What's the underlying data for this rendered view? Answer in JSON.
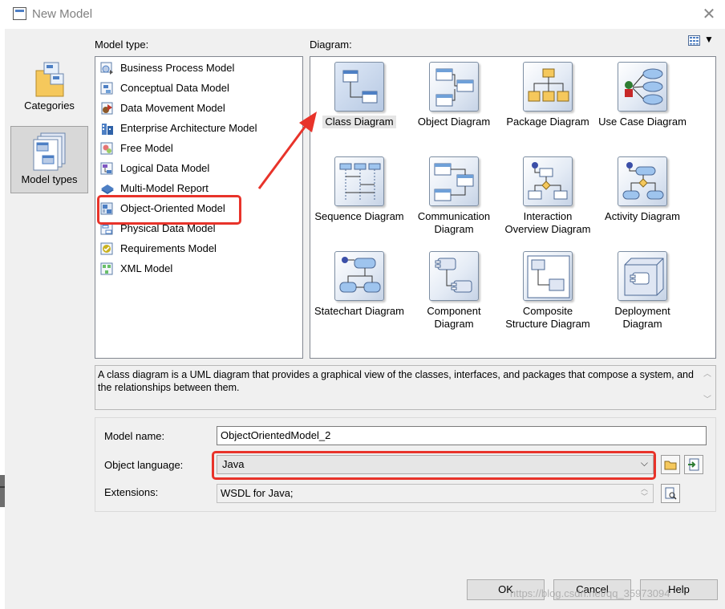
{
  "window": {
    "title": "New Model",
    "close_glyph": "✕"
  },
  "categories": [
    {
      "label": "Categories",
      "icon": "folder-icon"
    },
    {
      "label": "Model types",
      "icon": "model-types-icon"
    }
  ],
  "model_type_label": "Model type:",
  "diagram_label": "Diagram:",
  "model_types": [
    {
      "label": "Business Process Model",
      "icon": "business-process-icon"
    },
    {
      "label": "Conceptual Data Model",
      "icon": "conceptual-data-icon"
    },
    {
      "label": "Data Movement Model",
      "icon": "data-movement-icon"
    },
    {
      "label": "Enterprise Architecture Model",
      "icon": "enterprise-architecture-icon"
    },
    {
      "label": "Free Model",
      "icon": "free-model-icon"
    },
    {
      "label": "Logical Data Model",
      "icon": "logical-data-icon"
    },
    {
      "label": "Multi-Model Report",
      "icon": "report-icon"
    },
    {
      "label": "Object-Oriented Model",
      "icon": "object-oriented-icon"
    },
    {
      "label": "Physical Data Model",
      "icon": "physical-data-icon"
    },
    {
      "label": "Requirements Model",
      "icon": "requirements-icon"
    },
    {
      "label": "XML Model",
      "icon": "xml-model-icon"
    }
  ],
  "selected_model_type": "Object-Oriented Model",
  "diagrams": [
    {
      "label": "Class Diagram"
    },
    {
      "label": "Object Diagram"
    },
    {
      "label": "Package Diagram"
    },
    {
      "label": "Use Case Diagram"
    },
    {
      "label": "Sequence Diagram"
    },
    {
      "label": "Communication Diagram"
    },
    {
      "label": "Interaction Overview Diagram"
    },
    {
      "label": "Activity Diagram"
    },
    {
      "label": "Statechart Diagram"
    },
    {
      "label": "Component Diagram"
    },
    {
      "label": "Composite Structure Diagram"
    },
    {
      "label": "Deployment Diagram"
    }
  ],
  "selected_diagram": "Class Diagram",
  "description": "A class diagram is a UML diagram that provides a graphical view of the classes, interfaces, and packages that compose a system, and the relationships between them.",
  "form": {
    "model_name_label": "Model name:",
    "model_name_value": "ObjectOrientedModel_2",
    "object_language_label": "Object language:",
    "object_language_value": "Java",
    "extensions_label": "Extensions:",
    "extensions_value": "WSDL for Java;"
  },
  "buttons": {
    "ok": "OK",
    "cancel": "Cancel",
    "help": "Help"
  },
  "watermark": "https://blog.csdn.net/qq_35973094",
  "colors": {
    "highlight_red": "#e8332a",
    "accent_blue": "#4d7fc4"
  }
}
